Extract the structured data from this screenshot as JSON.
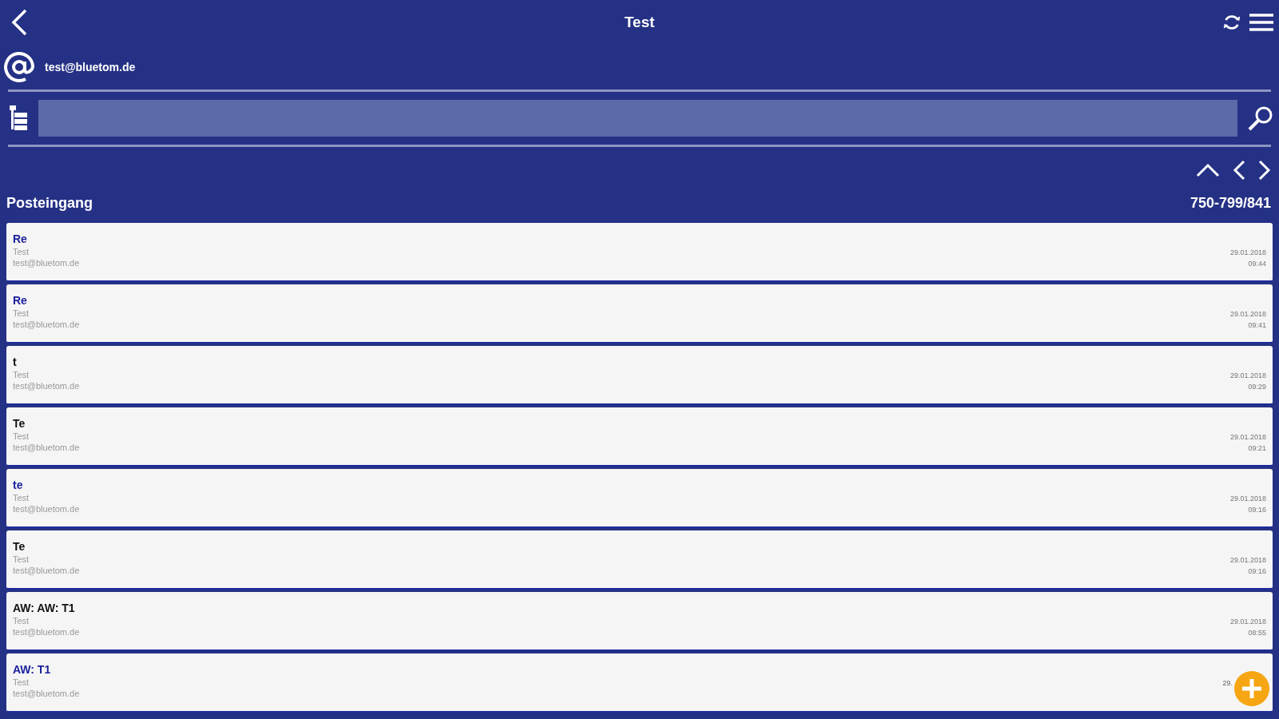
{
  "header": {
    "title": "Test"
  },
  "account": {
    "email": "test@bluetom.de"
  },
  "folder": {
    "name": "Posteingang",
    "range": "750-799/841"
  },
  "messages": [
    {
      "subject": "Re",
      "sender": "Test",
      "email": "test@bluetom.de",
      "date": "29.01.2018",
      "time": "09:44",
      "unread": true
    },
    {
      "subject": "Re",
      "sender": "Test",
      "email": "test@bluetom.de",
      "date": "29.01.2018",
      "time": "09:41",
      "unread": true
    },
    {
      "subject": "t",
      "sender": "Test",
      "email": "test@bluetom.de",
      "date": "29.01.2018",
      "time": "09:29",
      "unread": false
    },
    {
      "subject": "Te",
      "sender": "Test",
      "email": "test@bluetom.de",
      "date": "29.01.2018",
      "time": "09:21",
      "unread": false
    },
    {
      "subject": "te",
      "sender": "Test",
      "email": "test@bluetom.de",
      "date": "29.01.2018",
      "time": "09:16",
      "unread": true
    },
    {
      "subject": "Te",
      "sender": "Test",
      "email": "test@bluetom.de",
      "date": "29.01.2018",
      "time": "09:16",
      "unread": false
    },
    {
      "subject": "AW: AW: T1",
      "sender": "Test",
      "email": "test@bluetom.de",
      "date": "29.01.2018",
      "time": "08:55",
      "unread": false
    },
    {
      "subject": "AW: T1",
      "sender": "Test",
      "email": "test@bluetom.de",
      "date": "29.",
      "unread": true
    }
  ]
}
